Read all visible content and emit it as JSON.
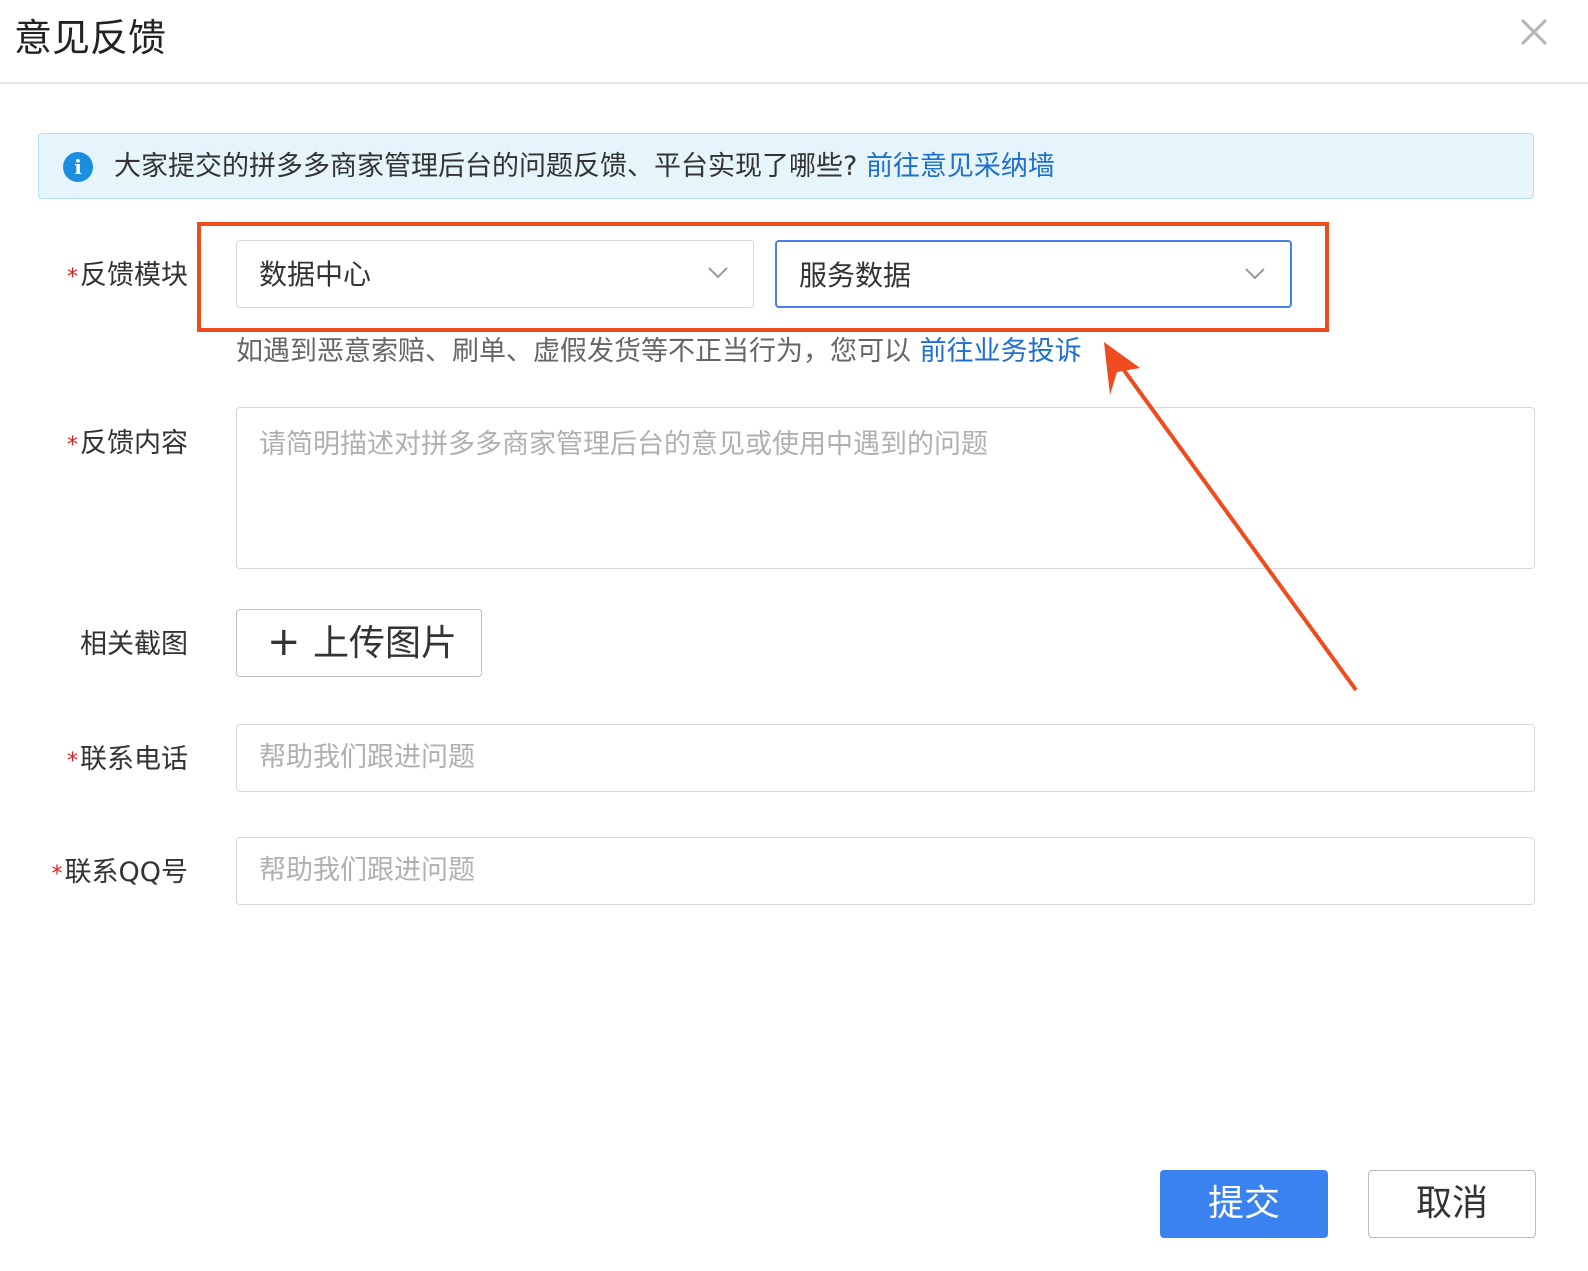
{
  "dialog": {
    "title": "意见反馈"
  },
  "notice": {
    "text": "大家提交的拼多多商家管理后台的问题反馈、平台实现了哪些?",
    "link": "前往意见采纳墙"
  },
  "form": {
    "required_mark": "*",
    "module": {
      "label": "反馈模块",
      "primary_select": "数据中心",
      "secondary_select": "服务数据",
      "hint_text": "如遇到恶意索赔、刷单、虚假发货等不正当行为，您可以",
      "hint_link": "前往业务投诉"
    },
    "content": {
      "label": "反馈内容",
      "placeholder": "请简明描述对拼多多商家管理后台的意见或使用中遇到的问题"
    },
    "screenshot": {
      "label": "相关截图",
      "upload_icon": "+",
      "upload_label": "上传图片"
    },
    "phone": {
      "label": "联系电话",
      "placeholder": "帮助我们跟进问题"
    },
    "qq": {
      "label": "联系QQ号",
      "placeholder": "帮助我们跟进问题"
    }
  },
  "buttons": {
    "submit": "提交",
    "cancel": "取消"
  },
  "colors": {
    "primary": "#3a82ef",
    "link": "#1f6fd0",
    "annotation": "#f04a1f",
    "required": "#e02020"
  }
}
